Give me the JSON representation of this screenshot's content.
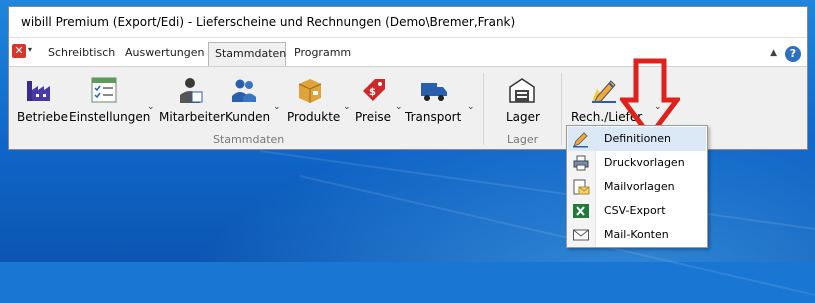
{
  "window": {
    "title": "wibill Premium (Export/Edi) - Lieferscheine und Rechnungen (Demo\\Bremer,Frank)"
  },
  "tabs": [
    "Schreibtisch",
    "Auswertungen",
    "Stammdaten",
    "Programm"
  ],
  "active_tab": "Stammdaten",
  "app_menu": {
    "glyph": "✕",
    "chevron": "▾"
  },
  "help": {
    "glyph": "?",
    "collapse": "▲"
  },
  "ribbon": {
    "buttons": [
      {
        "label": "Betriebe",
        "icon": "factory-icon"
      },
      {
        "label": "Einstellungen",
        "icon": "checklist-icon"
      },
      {
        "label": "Mitarbeiter",
        "icon": "employee-icon"
      },
      {
        "label": "Kunden",
        "icon": "customers-icon"
      },
      {
        "label": "Produkte",
        "icon": "box-icon"
      },
      {
        "label": "Preise",
        "icon": "price-tag-icon"
      },
      {
        "label": "Transport",
        "icon": "truck-icon"
      },
      {
        "label": "Lager",
        "icon": "warehouse-icon"
      },
      {
        "label": "Rech./Liefer",
        "icon": "invoice-edit-icon"
      }
    ],
    "chevron": "⌄",
    "groups": [
      "Stammdaten",
      "Lager"
    ]
  },
  "dropdown": {
    "items": [
      {
        "label": "Definitionen",
        "icon": "definitions-icon"
      },
      {
        "label": "Druckvorlagen",
        "icon": "printer-icon"
      },
      {
        "label": "Mailvorlagen",
        "icon": "mail-template-icon"
      },
      {
        "label": "CSV-Export",
        "icon": "excel-icon"
      },
      {
        "label": "Mail-Konten",
        "icon": "envelope-icon"
      }
    ]
  },
  "colors": {
    "annotation_arrow": "#e0201b",
    "menu_highlight": "#dbe9f7",
    "desktop": "#1066c8"
  }
}
